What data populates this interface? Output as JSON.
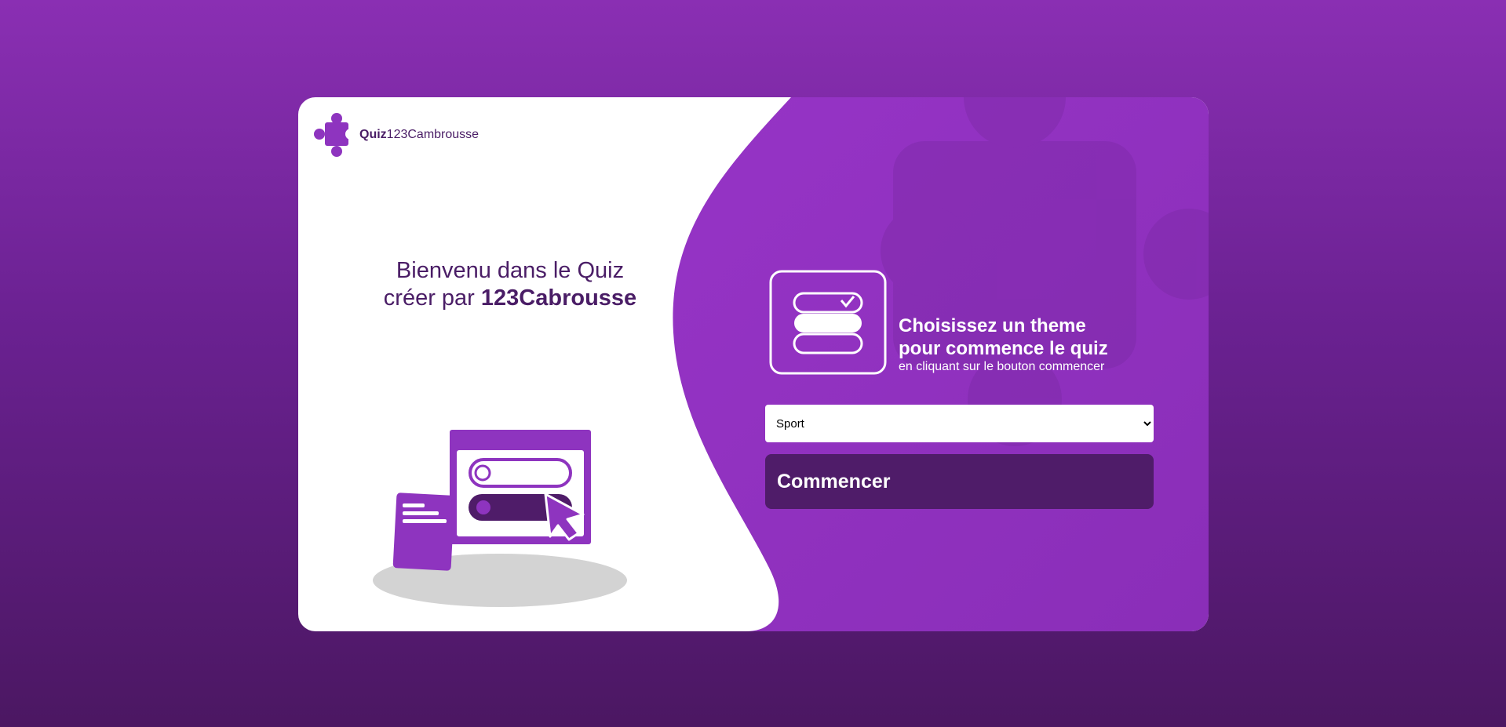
{
  "logo": {
    "bold_text": "Quiz",
    "rest_text": "123Cambrousse",
    "icon": "puzzle-piece-icon"
  },
  "welcome": {
    "line1": "Bienvenu dans le Quiz",
    "line2_prefix": "créer par ",
    "line2_bold": "123Cabrousse"
  },
  "theme": {
    "icon": "list-checked-icon",
    "title_line1": "Choisissez un theme",
    "title_line2": "pour commence le quiz",
    "subtitle": "en cliquant sur le bouton commencer"
  },
  "select": {
    "selected": "Sport",
    "options": [
      "Sport"
    ]
  },
  "start_button": {
    "label": "Commencer"
  },
  "colors": {
    "primary": "#8e34bf",
    "dark": "#4f1c69",
    "text": "#4a1d66",
    "shadow": "#d3d3d3"
  }
}
